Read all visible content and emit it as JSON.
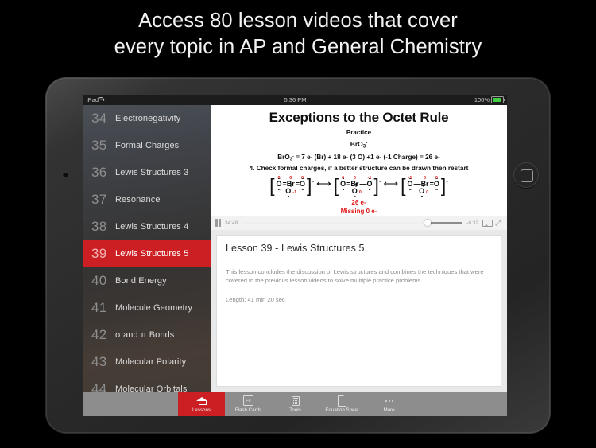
{
  "headline": {
    "line1": "Access 80 lesson videos that cover",
    "line2": "every topic in AP and General Chemistry"
  },
  "status_bar": {
    "carrier": "iPad",
    "wifi_icon": "wifi-icon",
    "time": "5:36 PM",
    "battery_percent": "100%",
    "battery_icon": "battery-full-icon",
    "battery_color": "#44cc44"
  },
  "sidebar": {
    "selected_index": 5,
    "selected_color": "#cc1f23",
    "items": [
      {
        "num": "34",
        "title": "Electronegativity"
      },
      {
        "num": "35",
        "title": "Formal Charges"
      },
      {
        "num": "36",
        "title": "Lewis Structures 3"
      },
      {
        "num": "37",
        "title": "Resonance"
      },
      {
        "num": "38",
        "title": "Lewis Structures 4"
      },
      {
        "num": "39",
        "title": "Lewis Structures 5"
      },
      {
        "num": "40",
        "title": "Bond Energy"
      },
      {
        "num": "41",
        "title": "Molecule Geometry"
      },
      {
        "num": "42",
        "title": "σ and π Bonds"
      },
      {
        "num": "43",
        "title": "Molecular Polarity"
      },
      {
        "num": "44",
        "title": "Molecular Orbitals"
      }
    ]
  },
  "slide": {
    "title": "Exceptions to the Octet Rule",
    "subtitle": "Practice",
    "formula_label": "BrO3-",
    "formula_base": "BrO",
    "formula_sub": "3",
    "formula_sup": "-",
    "equation": "BrO3- = 7 e- (Br) + 18 e- (3 O) +1 e- (-1 Charge) = 26 e-",
    "equation_rest": " = 7 e- (Br) + 18 e- (3 O) +1 e- (-1 Charge) = 26 e-",
    "step": "4. Check formal charges, if a better structure can be drawn then restart",
    "charge_color": "#e01b1b",
    "structures": [
      {
        "left_atom": "O",
        "left_charge": "0",
        "left_bond": "=",
        "center_atom": "Br",
        "center_charge": "0",
        "right_bond": "=",
        "right_atom": "O",
        "right_charge": "0",
        "bottom_atom": "O",
        "bottom_charge": "-1",
        "bracket_charge": "-"
      },
      {
        "left_atom": "O",
        "left_charge": "0",
        "left_bond": "=",
        "center_atom": "Br",
        "center_charge": "0",
        "right_bond": "—",
        "right_atom": "O",
        "right_charge": "-1",
        "bottom_atom": "O",
        "bottom_charge": "0",
        "bracket_charge": "-"
      },
      {
        "left_atom": "O",
        "left_charge": "-1",
        "left_bond": "—",
        "center_atom": "Br",
        "center_charge": "0",
        "right_bond": "=",
        "right_atom": "O",
        "right_charge": "0",
        "bottom_atom": "O",
        "bottom_charge": "0",
        "bracket_charge": "-"
      }
    ],
    "resonance_arrow": "⟷",
    "total_electrons": "26 e-",
    "missing_electrons": "Missing 0 e-"
  },
  "player": {
    "play_state_icon": "pause-icon",
    "elapsed": "34:48",
    "remaining": "-6:32",
    "progress_percent": 84,
    "airplay_icon": "airplay-icon",
    "fullscreen_icon": "expand-icon"
  },
  "description": {
    "heading": "Lesson 39  -  Lewis Structures 5",
    "body": "This lesson concludes the discussion of Lewis structures and combines the techniques that were covered in the previous lesson videos to solve multiple practice problems.",
    "length": "Length:  41 min 20 sec"
  },
  "tabbar": {
    "active_index": 0,
    "active_color": "#cc1f23",
    "tabs": [
      {
        "label": "Lessons",
        "icon": "graduation-cap-icon"
      },
      {
        "label": "Flash Cards",
        "icon": "element-card-icon",
        "icon_text": "Fe"
      },
      {
        "label": "Tools",
        "icon": "calculator-icon"
      },
      {
        "label": "Equation Sheet",
        "icon": "document-icon"
      },
      {
        "label": "More",
        "icon": "ellipsis-icon"
      }
    ]
  }
}
